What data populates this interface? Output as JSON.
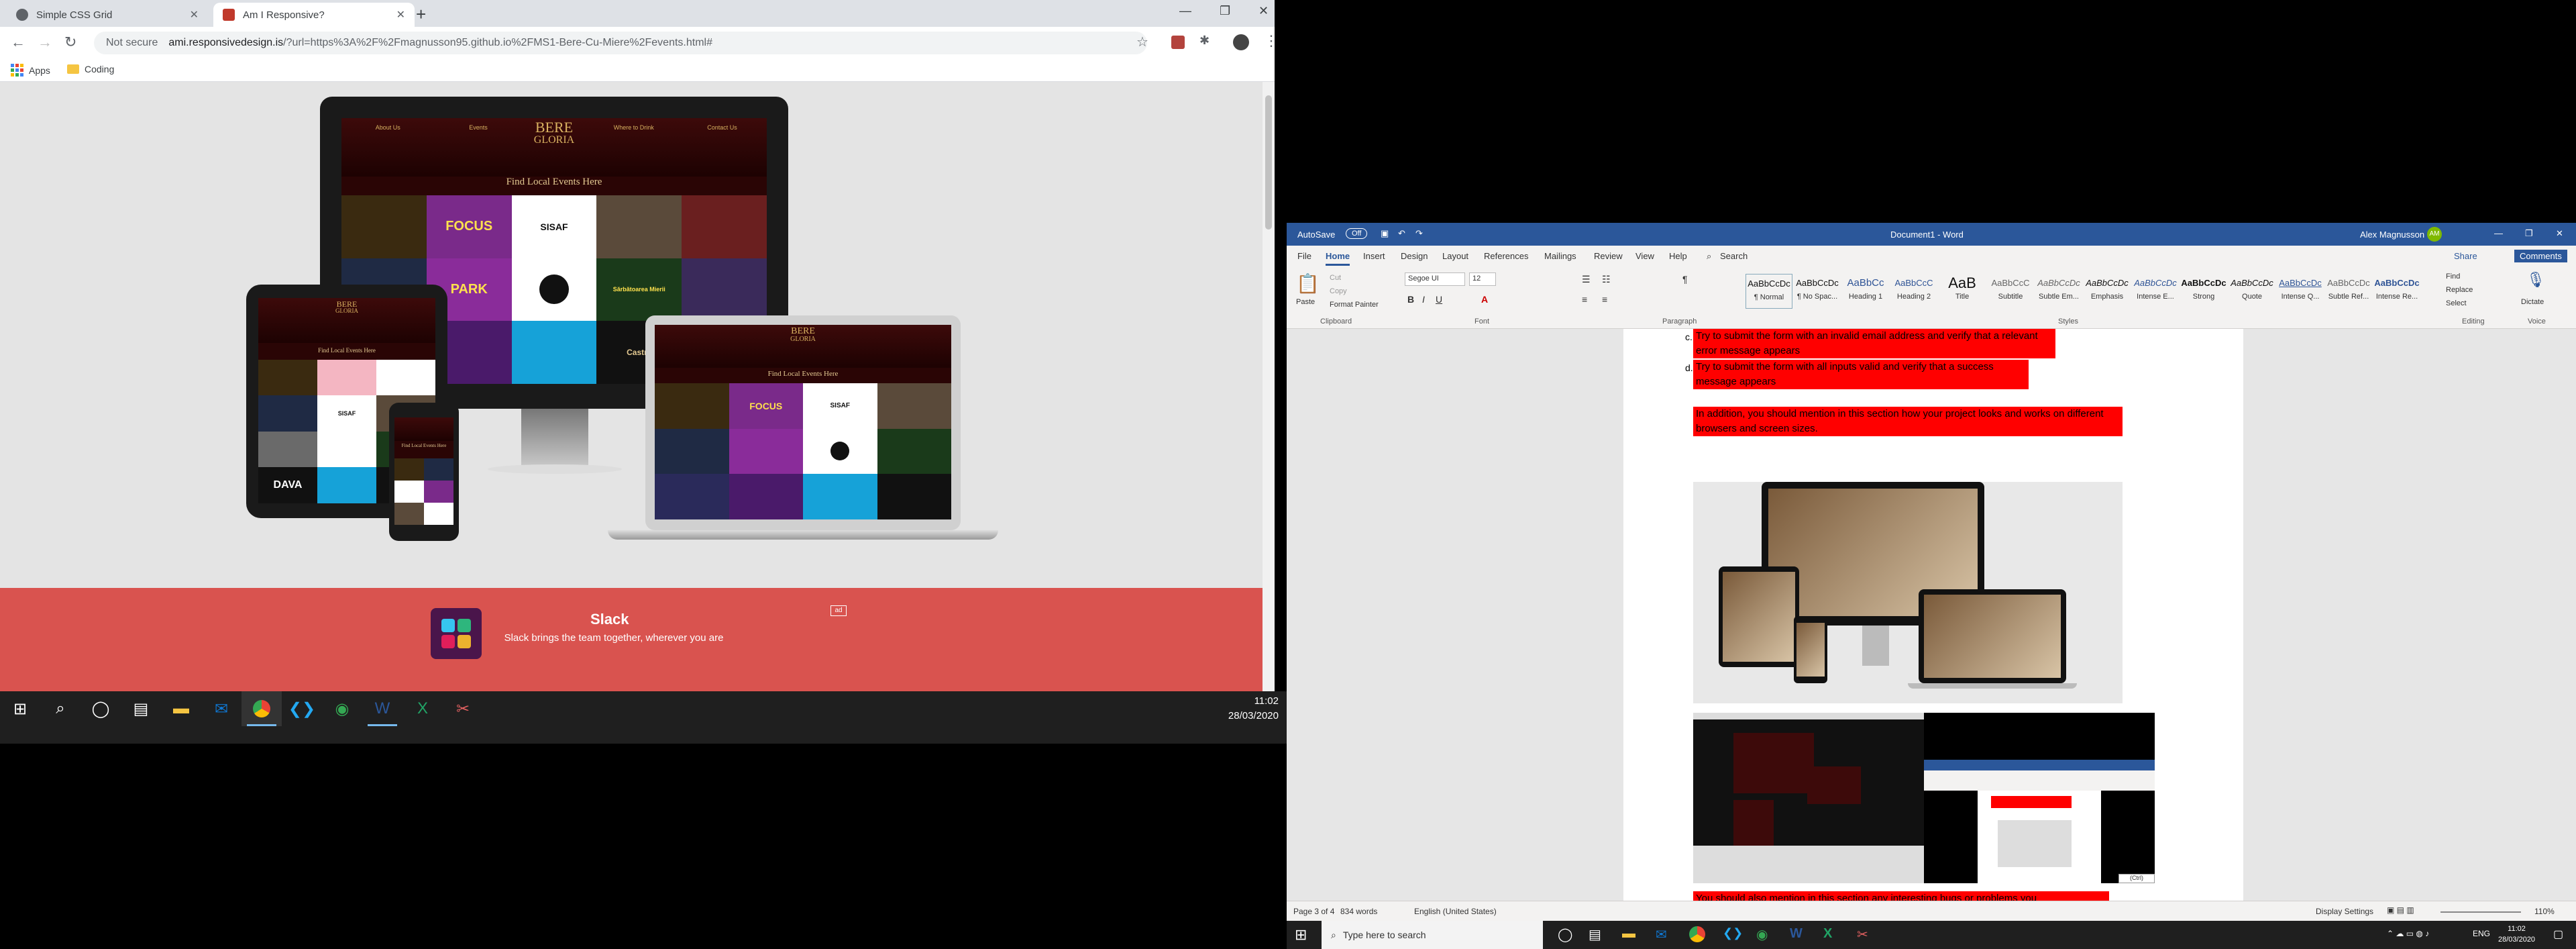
{
  "chrome": {
    "tabs": [
      {
        "title": "Simple CSS Grid",
        "active": false
      },
      {
        "title": "Am I Responsive?",
        "active": true
      }
    ],
    "address": {
      "security": "Not secure",
      "host": "ami.responsivedesign.is",
      "path": "/?url=https%3A%2F%2Fmagnusson95.github.io%2FMS1-Bere-Cu-Miere%2Fevents.html#"
    },
    "bookmarks": [
      "Apps",
      "Coding"
    ]
  },
  "mockup": {
    "site_nav": [
      "About Us",
      "Events",
      "Where to Drink",
      "Contact Us"
    ],
    "logo_line1": "BERE",
    "logo_line2": "GLORIA",
    "tagline": "Find Local Events Here",
    "tiles": [
      "FOCUS",
      "PARK",
      "SISAF",
      "DAVA",
      "Castra",
      "Sărbătoarea Mierii"
    ]
  },
  "slack_ad": {
    "title": "Slack",
    "description": "Slack brings the team together, wherever you are",
    "badge": "ad"
  },
  "taskbar_left": {
    "time": "11:02",
    "date": "28/03/2020"
  },
  "word": {
    "title": "Document1 - Word",
    "autosave_label": "AutoSave",
    "autosave_state": "Off",
    "user": "Alex Magnusson",
    "user_initials": "AM",
    "tabs": [
      "File",
      "Home",
      "Insert",
      "Design",
      "Layout",
      "References",
      "Mailings",
      "Review",
      "View",
      "Help"
    ],
    "search": "Search",
    "share": "Share",
    "comments": "Comments",
    "font_name": "Segoe UI",
    "font_size": "12",
    "clipboard": [
      "Paste",
      "Cut",
      "Copy",
      "Format Painter"
    ],
    "group_labels": [
      "Clipboard",
      "Font",
      "Paragraph",
      "Styles",
      "Editing",
      "Voice"
    ],
    "styles": [
      {
        "sample": "AaBbCcDc",
        "label": "¶ Normal"
      },
      {
        "sample": "AaBbCcDc",
        "label": "¶ No Spac..."
      },
      {
        "sample": "AaBbCc",
        "label": "Heading 1"
      },
      {
        "sample": "AaBbCcC",
        "label": "Heading 2"
      },
      {
        "sample": "AaB",
        "label": "Title"
      },
      {
        "sample": "AaBbCcC",
        "label": "Subtitle"
      },
      {
        "sample": "AaBbCcDc",
        "label": "Subtle Em..."
      },
      {
        "sample": "AaBbCcDc",
        "label": "Emphasis"
      },
      {
        "sample": "AaBbCcDc",
        "label": "Intense E..."
      },
      {
        "sample": "AaBbCcDc",
        "label": "Strong"
      },
      {
        "sample": "AaBbCcDc",
        "label": "Quote"
      },
      {
        "sample": "AaBbCcDc",
        "label": "Intense Q..."
      },
      {
        "sample": "AaBbCcDc",
        "label": "Subtle Ref..."
      },
      {
        "sample": "AaBbCcDc",
        "label": "Intense Re..."
      }
    ],
    "editing": [
      "Find",
      "Replace",
      "Select"
    ],
    "voice": "Dictate",
    "paragraphs": {
      "item_a": "Try to submit the form with an invalid email address and verify that a relevant error message appears",
      "item_b": "Try to submit the form with all inputs valid and verify that a success message appears",
      "p1": "In addition, you should mention in this section how your project looks and works on different browsers and screen sizes.",
      "p2": "You should also mention in this section any interesting bugs or problems you"
    },
    "paste_ctrl": "(Ctrl)",
    "status": {
      "page": "Page 3 of 4",
      "words": "834 words",
      "language": "English (United States)",
      "display": "Display Settings",
      "zoom": "110%"
    }
  },
  "taskbar_right": {
    "search_placeholder": "Type here to search",
    "lang": "ENG",
    "time": "11:02",
    "date": "28/03/2020"
  }
}
